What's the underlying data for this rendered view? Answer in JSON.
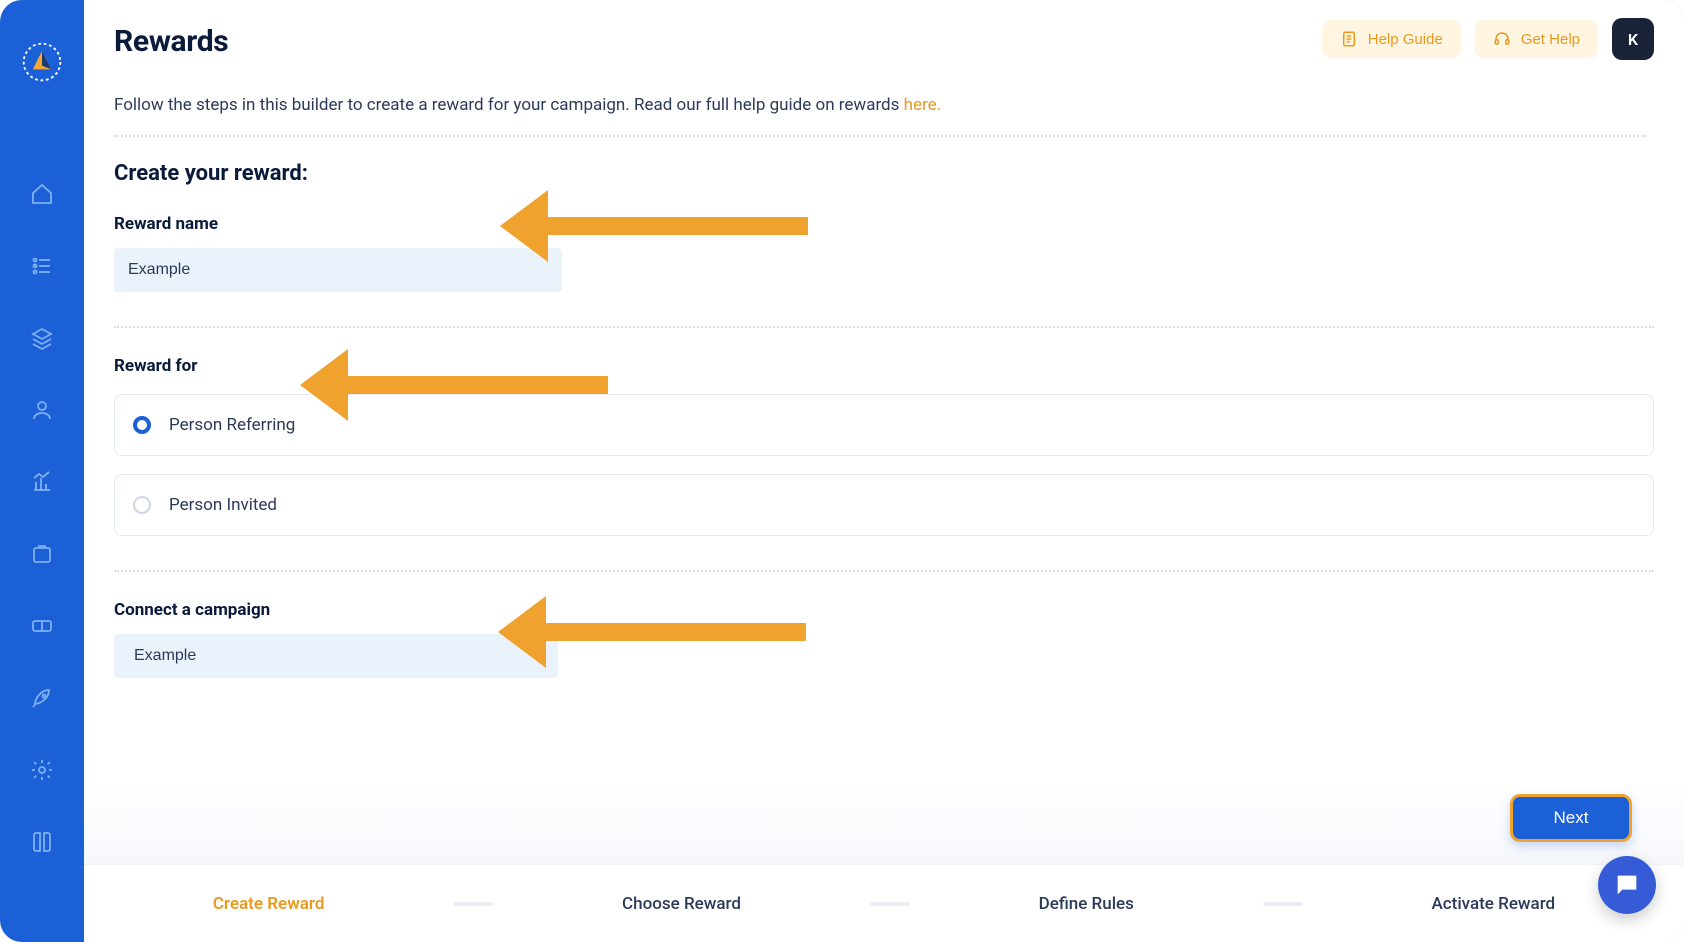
{
  "header": {
    "title": "Rewards",
    "subtext_prefix": "Follow the steps in this builder to create a reward for your campaign. Read our full help guide on rewards ",
    "subtext_link": "here.",
    "help_guide_label": "Help Guide",
    "get_help_label": "Get Help",
    "avatar_letter": "K"
  },
  "form": {
    "section_title": "Create your reward:",
    "reward_name_label": "Reward name",
    "reward_name_value": "Example",
    "reward_for_label": "Reward for",
    "reward_for_options": [
      {
        "label": "Person Referring",
        "selected": true
      },
      {
        "label": "Person Invited",
        "selected": false
      }
    ],
    "connect_label": "Connect a campaign",
    "connect_value": "Example"
  },
  "actions": {
    "next_label": "Next"
  },
  "stepper": {
    "steps": [
      {
        "label": "Create Reward",
        "active": true
      },
      {
        "label": "Choose Reward",
        "active": false
      },
      {
        "label": "Define Rules",
        "active": false
      },
      {
        "label": "Activate Reward",
        "active": false
      }
    ]
  },
  "colors": {
    "accent_blue": "#1c60d8",
    "accent_orange": "#f0a22f",
    "input_bg": "#eaf2fb"
  }
}
